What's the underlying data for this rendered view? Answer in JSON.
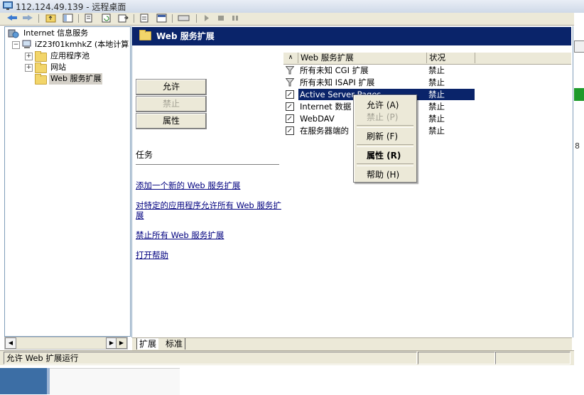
{
  "window": {
    "title": "112.124.49.139 - 远程桌面"
  },
  "tree": {
    "root": "Internet 信息服务",
    "computer": "iZ23f01kmhkZ (本地计算",
    "items": [
      {
        "label": "应用程序池"
      },
      {
        "label": "网站"
      },
      {
        "label": "Web 服务扩展"
      }
    ]
  },
  "header": {
    "title": "Web 服务扩展"
  },
  "actions": {
    "allow": "允许",
    "deny": "禁止",
    "properties": "属性"
  },
  "tasks": {
    "heading": "任务",
    "links": [
      "添加一个新的 Web 服务扩展",
      "对特定的应用程序允许所有 Web 服务扩展",
      "禁止所有 Web 服务扩展",
      "打开帮助"
    ]
  },
  "list": {
    "columns": [
      "Web 服务扩展",
      "状况"
    ],
    "rows": [
      {
        "name": "所有未知 CGI 扩展",
        "status": "禁止",
        "icon": "filter-icon"
      },
      {
        "name": "所有未知 ISAPI 扩展",
        "status": "禁止",
        "icon": "filter-icon"
      },
      {
        "name": "Active Server Pages",
        "status": "禁止",
        "icon": "extension-icon",
        "selected": true
      },
      {
        "name": "Internet 数据",
        "status": "禁止",
        "icon": "extension-icon"
      },
      {
        "name": "WebDAV",
        "status": "禁止",
        "icon": "extension-icon"
      },
      {
        "name": "在服务器端的",
        "status": "禁止",
        "icon": "extension-icon"
      }
    ]
  },
  "context_menu": {
    "items": [
      {
        "label": "允许 (A)",
        "enabled": true
      },
      {
        "label": "禁止 (P)",
        "enabled": false
      },
      {
        "label": "刷新 (F)",
        "enabled": true
      },
      {
        "label": "属性 (R)",
        "enabled": true,
        "bold": true
      },
      {
        "label": "帮助 (H)",
        "enabled": true
      }
    ]
  },
  "tabs": [
    "扩展",
    "标准"
  ],
  "status": {
    "text": "允许 Web 扩展运行"
  },
  "edge": {
    "partial_text": "8"
  },
  "colors": {
    "selection": "#0a246a",
    "link": "#00007f",
    "chrome": "#ece9d8"
  }
}
